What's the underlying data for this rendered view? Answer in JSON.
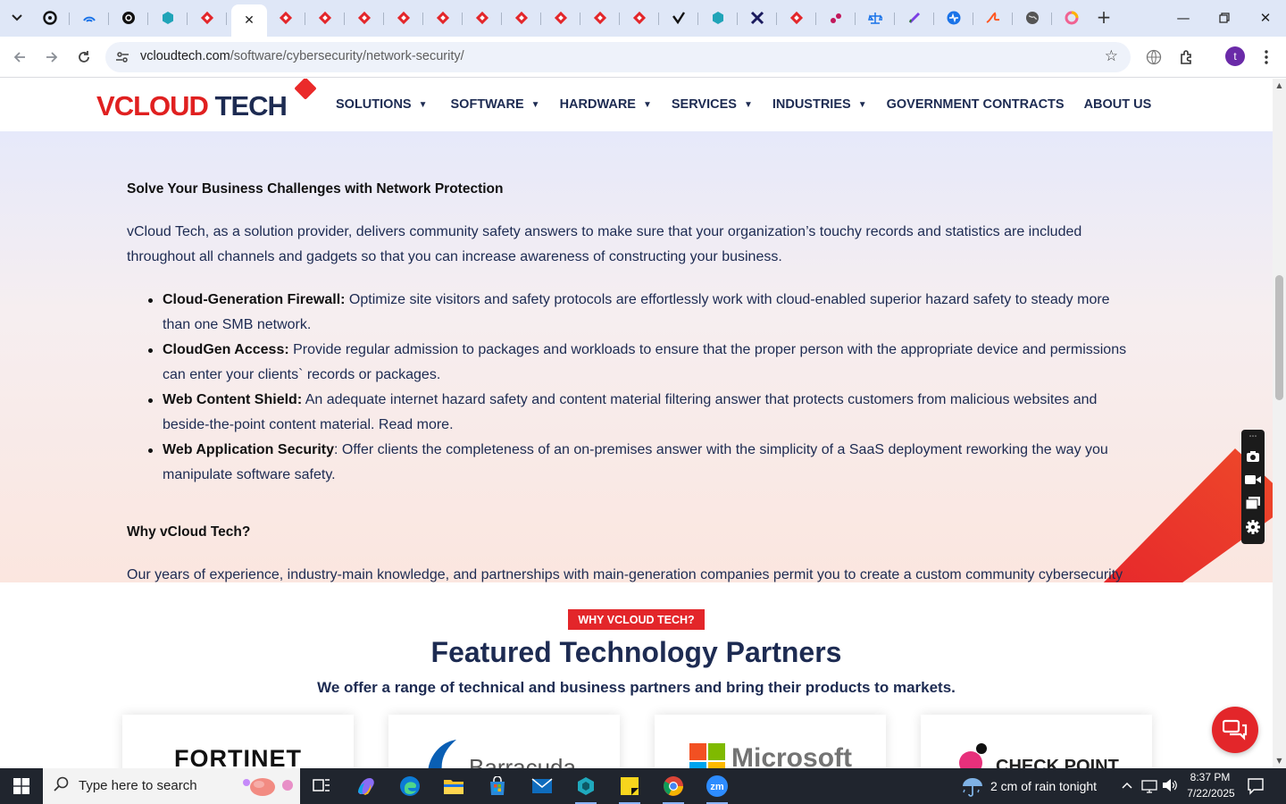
{
  "browser": {
    "tabs_count_label": "",
    "url_domain": "vcloudtech.com",
    "url_path": "/software/cybersecurity/network-security/",
    "profile_initial": "t"
  },
  "site": {
    "logo_text_v": "V",
    "logo_text_cloud": "CLOUD",
    "logo_text_tech": " TECH",
    "nav": [
      {
        "label": "SOLUTIONS",
        "caret": true
      },
      {
        "label": "SOFTWARE",
        "caret": true
      },
      {
        "label": "HARDWARE",
        "caret": true
      },
      {
        "label": "SERVICES",
        "caret": true
      },
      {
        "label": "INDUSTRIES",
        "caret": true
      },
      {
        "label": "GOVERNMENT CONTRACTS",
        "caret": false
      },
      {
        "label": "ABOUT US",
        "caret": false
      }
    ]
  },
  "content": {
    "heading_solve": "Solve Your Business Challenges with Network Protection",
    "para1": "vCloud Tech, as a solution provider, delivers community safety answers to make sure that your organization’s touchy records and statistics are included throughout all channels and gadgets so that you can increase awareness of constructing your business.",
    "bullets": [
      {
        "term": "Cloud-Generation Firewall:",
        "text": " Optimize site visitors and safety protocols are effortlessly work with cloud-enabled superior hazard safety to steady more than one SMB network."
      },
      {
        "term": "CloudGen Access:",
        "text": " Provide regular admission to packages and workloads to ensure that the proper person with the appropriate device and permissions can enter your clients` records or packages."
      },
      {
        "term": "Web Content Shield:",
        "text": " An adequate internet hazard safety and content material filtering answer that protects customers from malicious websites and beside-the-point content material. Read more."
      },
      {
        "term": "Web Application Security",
        "text": ": Offer clients the completeness of an on-premises answer with the simplicity of a SaaS deployment reworking the way you manipulate software safety."
      }
    ],
    "heading_why": "Why vCloud Tech?",
    "para2": "Our years of experience, industry-main knowledge, and partnerships with main-generation companies permit you to create a custom community cybersecurity answer that dynamically addresses vulnerabilities to your community, now and withinside the future."
  },
  "partners": {
    "badge": "WHY VCLOUD TECH?",
    "title": "Featured Technology Partners",
    "subtitle": "We offer a range of technical and business partners and bring their products to markets.",
    "logos": [
      "FORTINET",
      "Barracuda",
      "Microsoft",
      "CHECK POINT"
    ]
  },
  "taskbar": {
    "search_placeholder": "Type here to search",
    "weather": "2 cm of rain tonight",
    "time": "8:37 PM",
    "date": "7/22/2025"
  },
  "colors": {
    "brand_navy": "#1d2b52",
    "brand_red": "#e3262a",
    "chrome_tabstrip": "#dfe7f7"
  }
}
